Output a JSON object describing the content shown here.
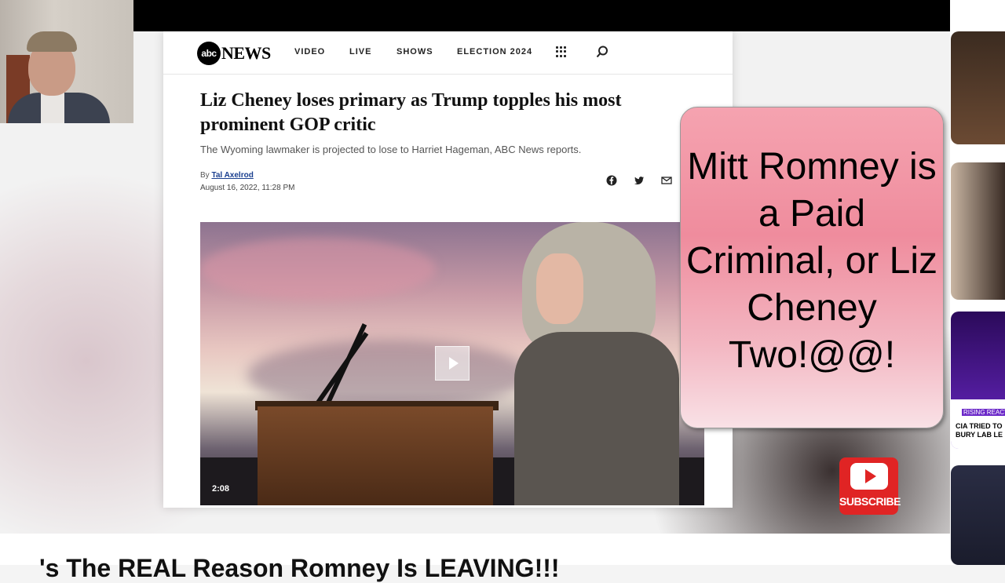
{
  "webcam": {
    "label": "webcam"
  },
  "nav": {
    "logo_abc": "abc",
    "logo_news": "NEWS",
    "items": [
      "VIDEO",
      "LIVE",
      "SHOWS",
      "ELECTION 2024"
    ]
  },
  "article": {
    "headline": "Liz Cheney loses primary as Trump topples his most prominent GOP critic",
    "subhead": "The Wyoming lawmaker is projected to lose to Harriet Hageman, ABC News reports.",
    "by_prefix": "By ",
    "author": "Tal Axelrod",
    "date": "August 16, 2022, 11:28 PM",
    "video_duration": "2:08"
  },
  "overlay": {
    "text": "Mitt Romney is a Paid Criminal, or Liz Cheney Two!@@!"
  },
  "subscribe": {
    "label": "SUBSCRIBE"
  },
  "sidebar": {
    "rising": "RISING REACT",
    "caption_line1": "CIA TRIED TO",
    "caption_line2": "BURY LAB LE"
  },
  "bottom": {
    "text": "'s The REAL Reason Romney Is LEAVING!!!"
  },
  "colors": {
    "accent": "#e02424",
    "overlay_pink": "#ef8c9d",
    "author_link": "#1a3f8f"
  }
}
